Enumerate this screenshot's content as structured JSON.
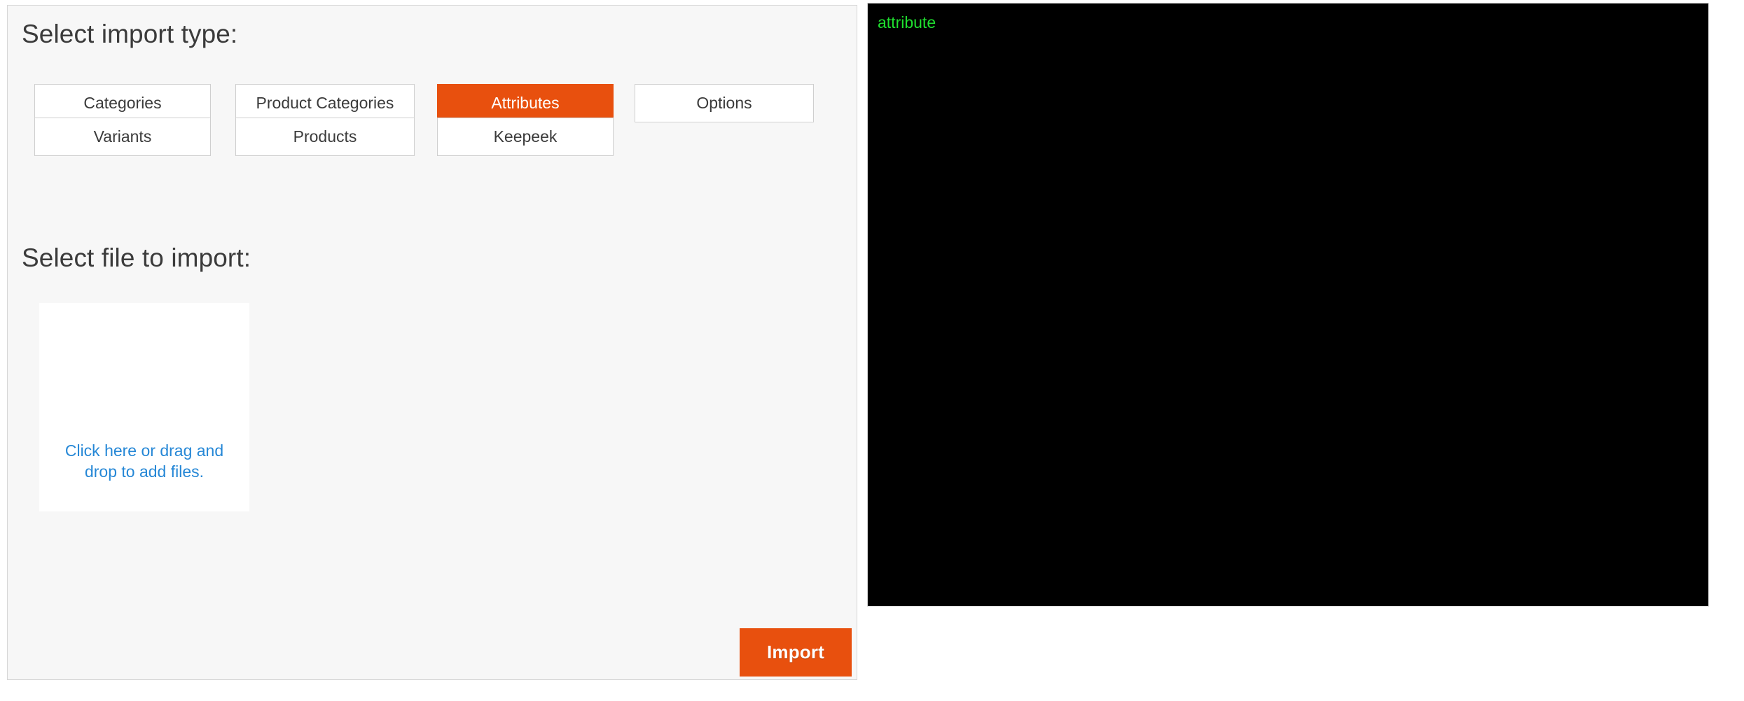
{
  "import_panel": {
    "headings": {
      "import_type": "Select import type:",
      "select_file": "Select file to import:"
    },
    "import_types": [
      {
        "id": "categories",
        "label": "Categories",
        "selected": false
      },
      {
        "id": "product-categories",
        "label": "Product Categories",
        "selected": false
      },
      {
        "id": "attributes",
        "label": "Attributes",
        "selected": true
      },
      {
        "id": "options",
        "label": "Options",
        "selected": false
      },
      {
        "id": "variants",
        "label": "Variants",
        "selected": false
      },
      {
        "id": "products",
        "label": "Products",
        "selected": false
      },
      {
        "id": "keepeek",
        "label": "Keepeek",
        "selected": false
      }
    ],
    "dropzone": {
      "message": "Click here or drag and drop to add files."
    },
    "actions": {
      "import_label": "Import"
    }
  },
  "console_panel": {
    "output": "attribute"
  },
  "colors": {
    "accent_orange": "#e8500e",
    "link_blue": "#2587d6",
    "console_green": "#1fe02f",
    "console_background": "#000000",
    "panel_background": "#f7f7f7",
    "panel_border": "#d6d6d6",
    "button_border": "#cfcfcf",
    "text_dark": "#3b3b3b"
  }
}
